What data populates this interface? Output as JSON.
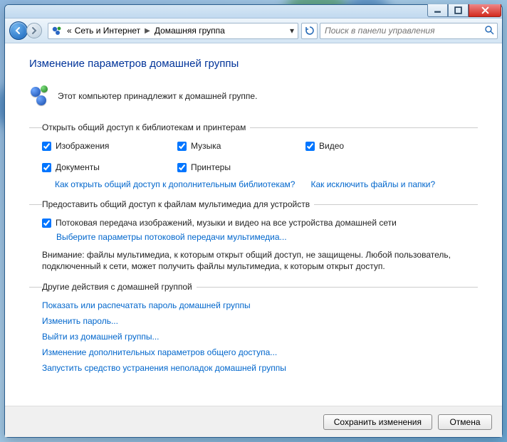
{
  "breadcrumb": {
    "seg1": "Сеть и Интернет",
    "seg2": "Домашняя группа",
    "prefix": "«"
  },
  "search": {
    "placeholder": "Поиск в панели управления"
  },
  "title": "Изменение параметров домашней группы",
  "belong": "Этот компьютер принадлежит к домашней группе.",
  "libs": {
    "legend": "Открыть общий доступ к библиотекам и принтерам",
    "items": [
      "Изображения",
      "Музыка",
      "Видео",
      "Документы",
      "Принтеры"
    ]
  },
  "help": {
    "more_libs": "Как открыть общий доступ к дополнительным библиотекам?",
    "exclude": "Как исключить файлы и папки?"
  },
  "stream": {
    "legend": "Предоставить общий доступ к файлам мультимедиа для устройств",
    "chk": "Потоковая передача изображений, музыки и видео на все устройства домашней сети",
    "link": "Выберите параметры потоковой передачи мультимедиа...",
    "warn": "Внимание: файлы мультимедиа, к которым открыт общий доступ, не защищены. Любой пользователь, подключенный к сети, может получить файлы мультимедиа, к которым открыт доступ."
  },
  "other": {
    "legend": "Другие действия с домашней группой",
    "links": [
      "Показать или распечатать пароль домашней группы",
      "Изменить пароль...",
      "Выйти из домашней группы...",
      "Изменение дополнительных параметров общего доступа...",
      "Запустить средство устранения неполадок домашней группы"
    ]
  },
  "buttons": {
    "save": "Сохранить изменения",
    "cancel": "Отмена"
  }
}
